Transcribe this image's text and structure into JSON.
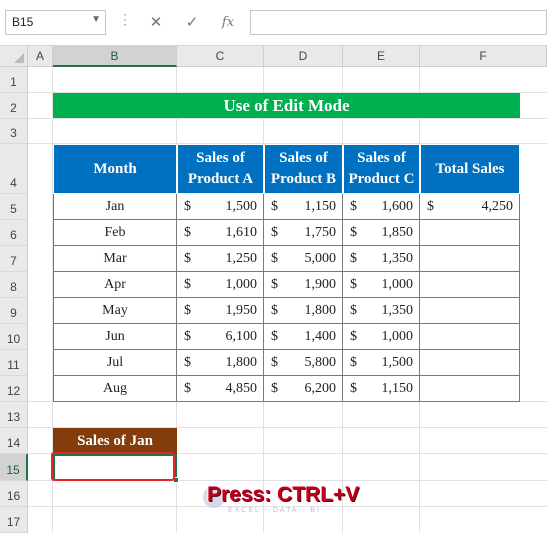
{
  "formula_bar": {
    "name_box": "B15",
    "name_box_dropdown_icon": "chevron-down-icon",
    "cancel_icon": "close-icon",
    "enter_icon": "check-icon",
    "fx_label": "fx",
    "formula_value": ""
  },
  "columns": [
    "A",
    "B",
    "C",
    "D",
    "E",
    "F"
  ],
  "selected_column": "B",
  "rows": [
    "1",
    "2",
    "3",
    "4",
    "5",
    "6",
    "7",
    "8",
    "9",
    "10",
    "11",
    "12",
    "13",
    "14",
    "15",
    "16",
    "17"
  ],
  "selected_row": "15",
  "title": "Use of Edit Mode",
  "table": {
    "headers": [
      [
        "Month"
      ],
      [
        "Sales of",
        "Product A"
      ],
      [
        "Sales of",
        "Product B"
      ],
      [
        "Sales of",
        "Product C"
      ],
      [
        "Total Sales"
      ]
    ],
    "currency_symbol": "$",
    "rows": [
      {
        "month": "Jan",
        "a": "1,500",
        "b": "1,150",
        "c": "1,600",
        "total": "4,250"
      },
      {
        "month": "Feb",
        "a": "1,610",
        "b": "1,750",
        "c": "1,850",
        "total": ""
      },
      {
        "month": "Mar",
        "a": "1,250",
        "b": "5,000",
        "c": "1,350",
        "total": ""
      },
      {
        "month": "Apr",
        "a": "1,000",
        "b": "1,900",
        "c": "1,000",
        "total": ""
      },
      {
        "month": "May",
        "a": "1,950",
        "b": "1,800",
        "c": "1,350",
        "total": ""
      },
      {
        "month": "Jun",
        "a": "6,100",
        "b": "1,400",
        "c": "1,000",
        "total": ""
      },
      {
        "month": "Jul",
        "a": "1,800",
        "b": "5,800",
        "c": "1,500",
        "total": ""
      },
      {
        "month": "Aug",
        "a": "4,850",
        "b": "6,200",
        "c": "1,150",
        "total": ""
      }
    ]
  },
  "sales_of_jan": {
    "label": "Sales of Jan",
    "value": ""
  },
  "overlay": {
    "instruction": "Press: CTRL+V",
    "watermark": "EXCEL · DATA · BI"
  },
  "colors": {
    "title_bg": "#00b050",
    "header_bg": "#0070c0",
    "label_bg": "#833c0b",
    "highlight": "#e8262a",
    "selection": "#217346"
  }
}
